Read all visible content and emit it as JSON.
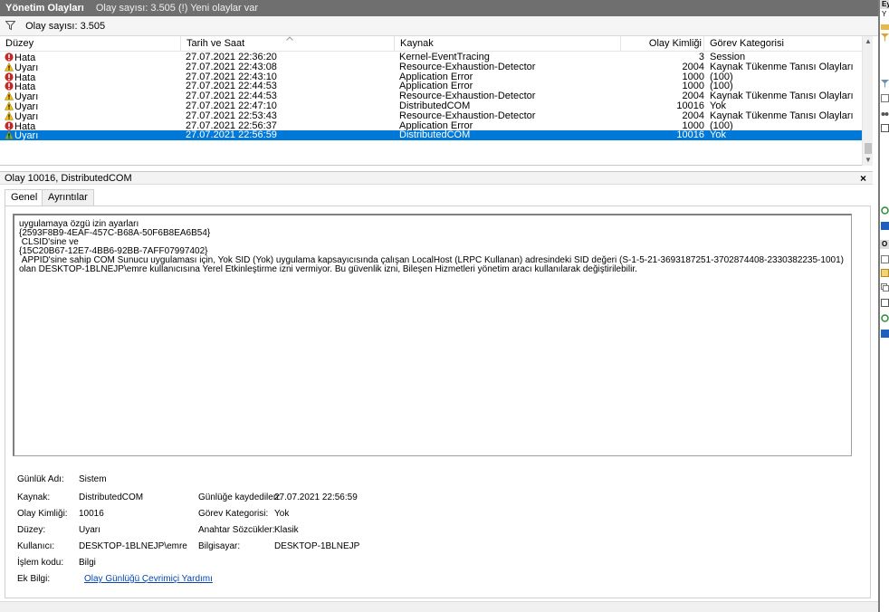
{
  "titlebar": {
    "title": "Yönetim Olayları",
    "subtitle": "Olay sayısı: 3.505 (!) Yeni olaylar var"
  },
  "filterbar": {
    "text": "Olay sayısı: 3.505"
  },
  "grid": {
    "columns": [
      "Düzey",
      "Tarih ve Saat",
      "Kaynak",
      "Olay Kimliği",
      "Görev Kategorisi"
    ],
    "rows": [
      {
        "level": "Hata",
        "date": "27.07.2021 22:36:20",
        "source": "Kernel-EventTracing",
        "id": "3",
        "category": "Session"
      },
      {
        "level": "Uyarı",
        "date": "27.07.2021 22:43:08",
        "source": "Resource-Exhaustion-Detector",
        "id": "2004",
        "category": "Kaynak Tükenme Tanısı Olayları"
      },
      {
        "level": "Hata",
        "date": "27.07.2021 22:43:10",
        "source": "Application Error",
        "id": "1000",
        "category": "(100)"
      },
      {
        "level": "Hata",
        "date": "27.07.2021 22:44:53",
        "source": "Application Error",
        "id": "1000",
        "category": "(100)"
      },
      {
        "level": "Uyarı",
        "date": "27.07.2021 22:44:53",
        "source": "Resource-Exhaustion-Detector",
        "id": "2004",
        "category": "Kaynak Tükenme Tanısı Olayları"
      },
      {
        "level": "Uyarı",
        "date": "27.07.2021 22:47:10",
        "source": "DistributedCOM",
        "id": "10016",
        "category": "Yok"
      },
      {
        "level": "Uyarı",
        "date": "27.07.2021 22:53:43",
        "source": "Resource-Exhaustion-Detector",
        "id": "2004",
        "category": "Kaynak Tükenme Tanısı Olayları"
      },
      {
        "level": "Hata",
        "date": "27.07.2021 22:56:37",
        "source": "Application Error",
        "id": "1000",
        "category": "(100)"
      },
      {
        "level": "Uyarı",
        "date": "27.07.2021 22:56:59",
        "source": "DistributedCOM",
        "id": "10016",
        "category": "Yok",
        "selected": true
      }
    ]
  },
  "detail": {
    "header": "Olay 10016, DistributedCOM",
    "close": "×",
    "tabs": [
      "Genel",
      "Ayrıntılar"
    ],
    "description": "uygulamaya özgü izin ayarları\n{2593F8B9-4EAF-457C-B68A-50F6B8EA6B54}\n CLSID'sine ve\n{15C20B67-12E7-4BB6-92BB-7AFF07997402}\n APPID'sine sahip COM Sunucu uygulaması için, Yok SID (Yok) uygulama kapsayıcısında çalışan LocalHost (LRPC Kullanan) adresindeki SID değeri (S-1-5-21-3693187251-3702874408-2330382235-1001) olan DESKTOP-1BLNEJP\\emre kullanıcısına Yerel Etkinleştirme izni vermiyor. Bu güvenlik izni, Bileşen Hizmetleri yönetim aracı kullanılarak değiştirilebilir.",
    "props": {
      "log_label": "Günlük Adı:",
      "log_value": "Sistem",
      "source_label": "Kaynak:",
      "source_value": "DistributedCOM",
      "logged_label": "Günlüğe kaydedilen:",
      "logged_value": "27.07.2021 22:56:59",
      "eventid_label": "Olay Kimliği:",
      "eventid_value": "10016",
      "task_label": "Görev Kategorisi:",
      "task_value": "Yok",
      "level_label": "Düzey:",
      "level_value": "Uyarı",
      "keywords_label": "Anahtar Sözcükler:",
      "keywords_value": "Klasik",
      "user_label": "Kullanıcı:",
      "user_value": "DESKTOP-1BLNEJP\\emre",
      "computer_label": "Bilgisayar:",
      "computer_value": "DESKTOP-1BLNEJP",
      "opcode_label": "İşlem kodu:",
      "opcode_value": "Bilgi",
      "more_label": "Ek Bilgi:",
      "more_link": "Olay Günlüğü Çevrimiçi Yardımı"
    }
  },
  "rightpane": {
    "header1": "Ey",
    "header2": "Y",
    "header3": "O"
  },
  "colors": {
    "selection": "#0078d7",
    "error": "#c62828",
    "warning": "#f4c20d",
    "titlebar": "#6f6f6f"
  }
}
